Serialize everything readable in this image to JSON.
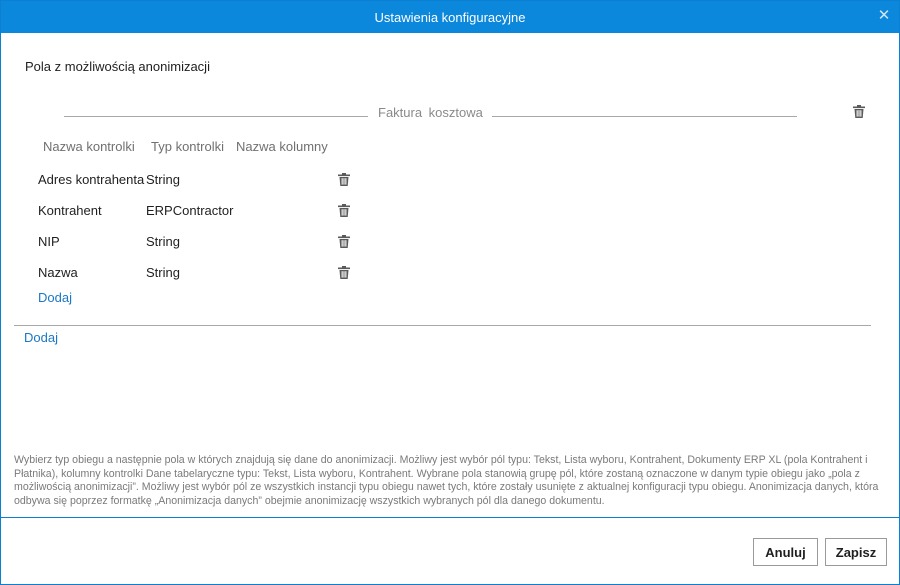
{
  "window": {
    "title": "Ustawienia konfiguracyjne",
    "close_symbol": "✕"
  },
  "section": {
    "title": "Pola z możliwością anonimizacji"
  },
  "group": {
    "title": "Faktura  kosztowa",
    "columns": [
      "Nazwa kontrolki",
      "Typ kontrolki",
      "Nazwa kolumny"
    ],
    "rows": [
      {
        "name": "Adres kontrahenta",
        "type": "String",
        "column": ""
      },
      {
        "name": "Kontrahent",
        "type": "ERPContractor",
        "column": ""
      },
      {
        "name": "NIP",
        "type": "String",
        "column": ""
      },
      {
        "name": "Nazwa",
        "type": "String",
        "column": ""
      }
    ],
    "add_label": "Dodaj"
  },
  "add_group_label": "Dodaj",
  "info_text": "Wybierz typ obiegu a następnie pola w których znajdują się dane do anonimizacji. Możliwy jest wybór pól typu: Tekst, Lista wyboru, Kontrahent, Dokumenty ERP XL (pola Kontrahent i Płatnika), kolumny kontrolki Dane tabelaryczne typu: Tekst, Lista wyboru, Kontrahent. Wybrane pola stanowią grupę pól, które zostaną oznaczone w danym typie obiegu jako „pola z możliwością anonimizacji”. Możliwy jest wybór pól ze wszystkich instancji typu obiegu nawet tych, które zostały usunięte z aktualnej konfiguracji typu obiegu. Anonimizacja danych, która odbywa się poprzez formatkę „Anonimizacja danych” obejmie anonimizację wszystkich wybranych pól dla danego dokumentu.",
  "buttons": {
    "cancel": "Anuluj",
    "save": "Zapisz"
  },
  "colors": {
    "titlebar": "#0b87dc",
    "link": "#1b78c6",
    "icon": "#5a5a5a"
  },
  "icons": {
    "close": "close-icon",
    "delete": "trash-icon"
  }
}
